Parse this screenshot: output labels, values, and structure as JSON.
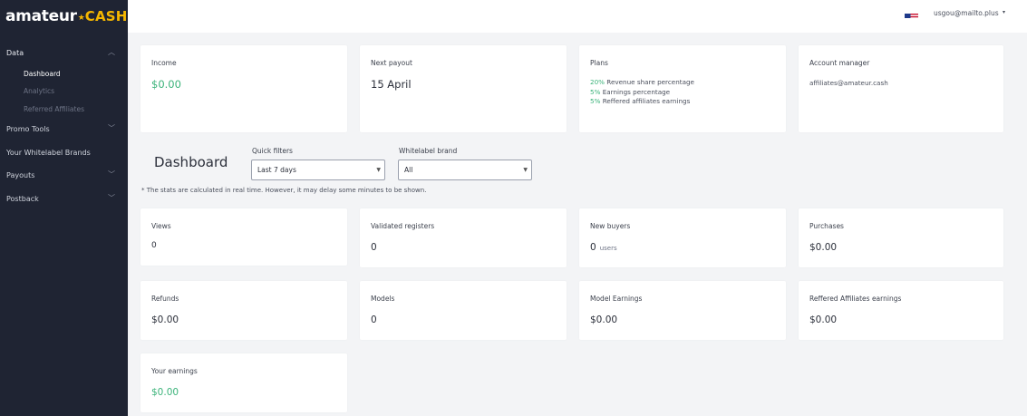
{
  "brand": {
    "logo_text_1": "amateur",
    "logo_text_2": "CASH"
  },
  "sidebar": {
    "data": {
      "label": "Data",
      "expanded": true
    },
    "sub_items": [
      {
        "label": "Dashboard",
        "active": true
      },
      {
        "label": "Analytics"
      },
      {
        "label": "Referred Affiliates"
      }
    ],
    "items": [
      {
        "label": "Promo Tools",
        "has_chevron": true
      },
      {
        "label": "Your Whitelabel Brands",
        "has_chevron": false
      },
      {
        "label": "Payouts",
        "has_chevron": true
      },
      {
        "label": "Postback",
        "has_chevron": true
      }
    ]
  },
  "topbar": {
    "user_email": "usgou@mailto.plus",
    "flag": "us-flag-icon"
  },
  "summary": {
    "income": {
      "title": "Income",
      "value": "$0.00"
    },
    "next_payout": {
      "title": "Next payout",
      "value": "15 April"
    },
    "plans": {
      "title": "Plans",
      "lines": [
        {
          "pct": "20%",
          "text": " Revenue share percentage"
        },
        {
          "pct": "5%",
          "text": " Earnings percentage"
        },
        {
          "pct": "5%",
          "text": " Reffered affiliates earnings"
        }
      ]
    },
    "account_manager": {
      "title": "Account manager",
      "email": "affiliates@amateur.cash"
    }
  },
  "dashboard": {
    "title": "Dashboard",
    "quick_filters": {
      "label": "Quick filters",
      "value": "Last 7 days"
    },
    "whitelabel": {
      "label": "Whitelabel brand",
      "value": "All"
    },
    "note": "* The stats are calculated in real time. However, it may delay some minutes to be shown."
  },
  "stats": {
    "views": {
      "title": "Views",
      "value": "0"
    },
    "validated_registers": {
      "title": "Validated registers",
      "value": "0"
    },
    "new_buyers": {
      "title": "New buyers",
      "value": "0",
      "unit": "users"
    },
    "purchases": {
      "title": "Purchases",
      "value": "$0.00"
    },
    "refunds": {
      "title": "Refunds",
      "value": "$0.00"
    },
    "models": {
      "title": "Models",
      "value": "0"
    },
    "model_earnings": {
      "title": "Model Earnings",
      "value": "$0.00"
    },
    "referred_affiliates_earnings": {
      "title": "Reffered Affiliates earnings",
      "value": "$0.00"
    },
    "your_earnings": {
      "title": "Your earnings",
      "value": "$0.00"
    }
  },
  "colors": {
    "sidebar_bg": "#1f2433",
    "accent_green": "#3bb37a",
    "logo_yellow": "#f5b700"
  }
}
